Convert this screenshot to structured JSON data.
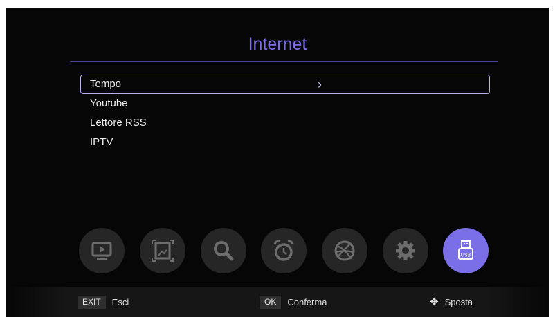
{
  "header": {
    "title": "Internet"
  },
  "menu": {
    "items": [
      {
        "label": "Tempo",
        "chevron": "›"
      },
      {
        "label": "Youtube"
      },
      {
        "label": "Lettore RSS"
      },
      {
        "label": "IPTV"
      }
    ],
    "selected_index": 0
  },
  "toolbar": {
    "icons": [
      "tv-icon",
      "picture-icon",
      "search-icon",
      "alarm-clock-icon",
      "globe-icon",
      "settings-gear-icon",
      "usb-icon"
    ],
    "active_icon": "usb-icon",
    "usb_label": "USB"
  },
  "footer": {
    "exit_key": "EXIT",
    "exit_label": "Esci",
    "ok_key": "OK",
    "ok_label": "Conferma",
    "move_icon": "✥",
    "move_label": "Sposta"
  },
  "colors": {
    "accent": "#7b6fe8",
    "background": "#060606"
  }
}
